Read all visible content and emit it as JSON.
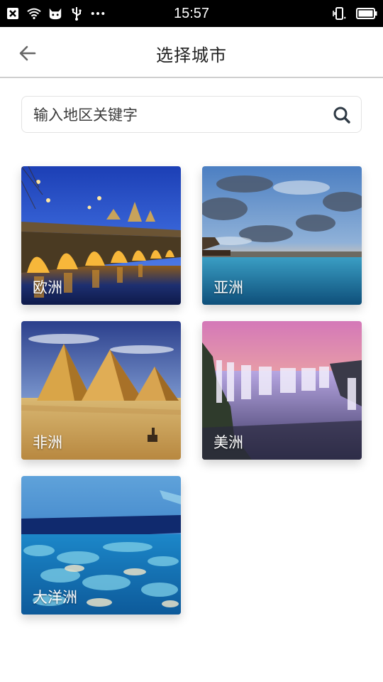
{
  "status_bar": {
    "time": "15:57",
    "left_icons": [
      "close-notification-icon",
      "wifi-icon",
      "cat-app-icon",
      "usb-icon",
      "more-dots-icon"
    ],
    "right_icons": [
      "vibrate-icon",
      "battery-icon"
    ]
  },
  "header": {
    "title": "选择城市",
    "back_icon": "arrow-left-icon"
  },
  "search": {
    "placeholder": "输入地区关键字",
    "value": "",
    "icon": "search-icon"
  },
  "regions": [
    {
      "label": "欧洲"
    },
    {
      "label": "亚洲"
    },
    {
      "label": "非洲"
    },
    {
      "label": "美洲"
    },
    {
      "label": "大洋洲"
    }
  ],
  "colors": {
    "status_bar_bg": "#000000",
    "header_divider": "#cfcfcf",
    "search_icon": "#2f3a45"
  }
}
